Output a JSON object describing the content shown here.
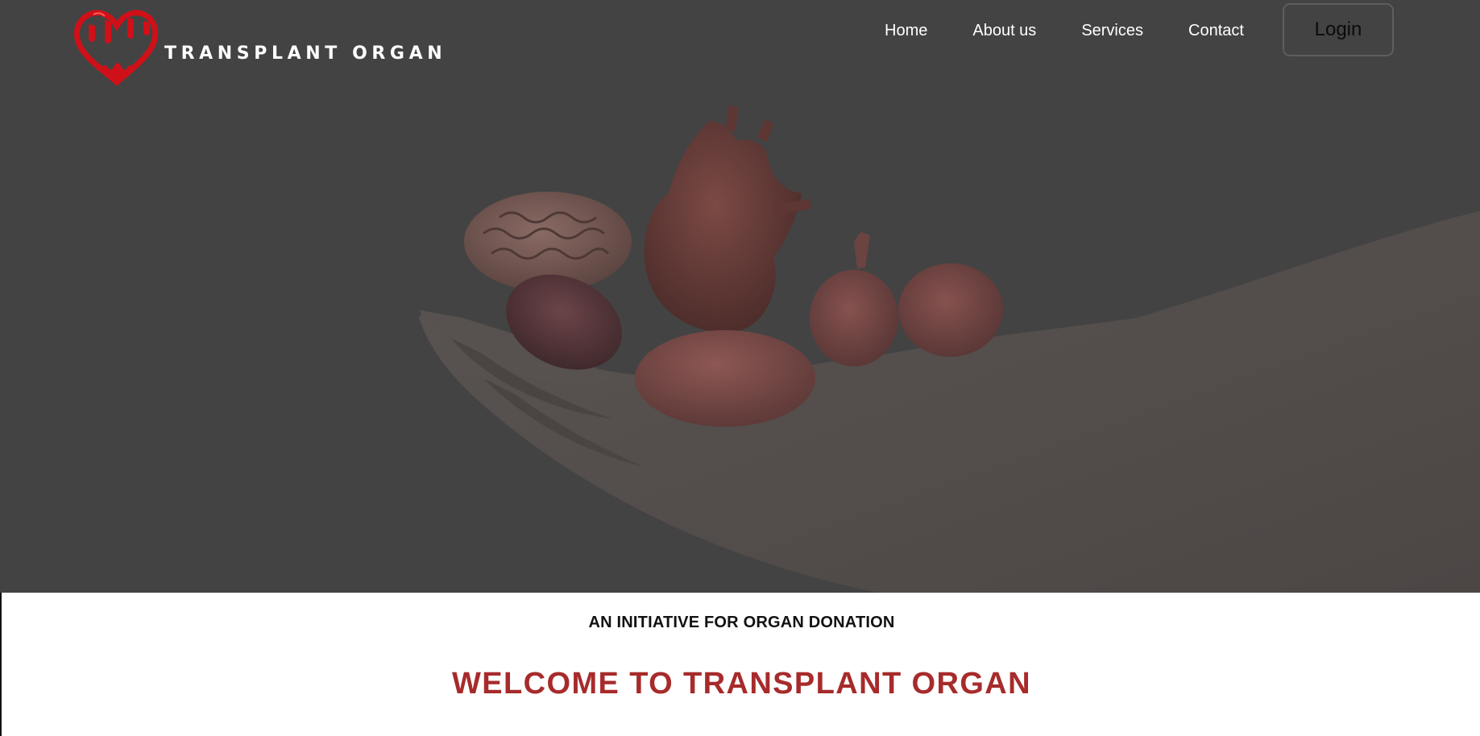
{
  "site": {
    "brand_name": "TRANSPLANT ORGAN",
    "logo_icon": "dripping-heart-icon"
  },
  "nav": {
    "items": [
      {
        "label": "Home"
      },
      {
        "label": "About us"
      },
      {
        "label": "Services"
      },
      {
        "label": "Contact"
      }
    ],
    "login_label": "Login"
  },
  "hero": {
    "image": "hand-holding-organs-image",
    "overlay_color": "#434343"
  },
  "content": {
    "tagline": "AN INITIATIVE FOR ORGAN DONATION",
    "welcome_title": "WELCOME TO TRANSPLANT ORGAN"
  },
  "colors": {
    "accent": "#a72b2b",
    "logo_red": "#d01018",
    "hero_background": "#434343",
    "text_dark": "#111111"
  }
}
